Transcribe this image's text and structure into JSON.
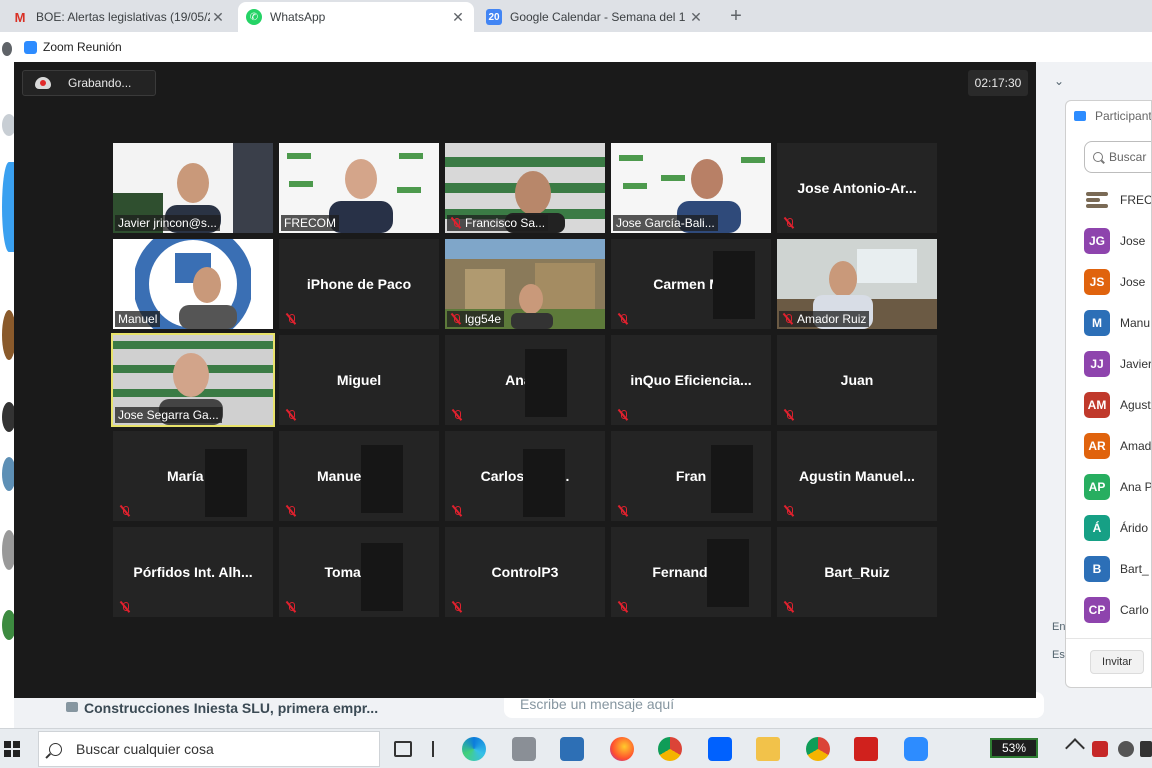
{
  "browser": {
    "tabs": [
      {
        "title": "BOE: Alertas legislativas (19/05/2",
        "icon": "gmail-icon",
        "active": false
      },
      {
        "title": "WhatsApp",
        "icon": "whatsapp-icon",
        "active": true
      },
      {
        "title": "Google Calendar - Semana del 1",
        "icon": "calendar-icon",
        "active": false,
        "badge": "20"
      }
    ],
    "new_tab": "+"
  },
  "zoom": {
    "window_title": "Zoom Reunión",
    "recording_label": "Grabando...",
    "timer": "02:17:30",
    "tiles": [
      {
        "name": "Javier jrincon@s...",
        "video": true,
        "muted": false
      },
      {
        "name": "FRECOM",
        "video": true,
        "muted": false
      },
      {
        "name": "Francisco Sa...",
        "video": true,
        "muted": true
      },
      {
        "name": "Jose García-Bali...",
        "video": true,
        "muted": false
      },
      {
        "name": "Jose  Antonio-Ar...",
        "video": false,
        "muted": true
      },
      {
        "name": "Manuel",
        "video": true,
        "muted": false
      },
      {
        "name": "iPhone de Paco",
        "video": false,
        "muted": true
      },
      {
        "name": "lgg54e",
        "video": true,
        "muted": true
      },
      {
        "name": "Carmen  Ma",
        "video": false,
        "muted": true
      },
      {
        "name": "Amador Ruiz",
        "video": true,
        "muted": true
      },
      {
        "name": "Jose Segarra Ga...",
        "video": true,
        "muted": false,
        "active_speaker": true
      },
      {
        "name": "Miguel",
        "video": false,
        "muted": true
      },
      {
        "name": "Ana P",
        "video": false,
        "muted": true
      },
      {
        "name": "inQuo  Eficiencia...",
        "video": false,
        "muted": true
      },
      {
        "name": "Juan",
        "video": false,
        "muted": true
      },
      {
        "name": "María M",
        "video": false,
        "muted": true
      },
      {
        "name": "Manuel  S          z...",
        "video": false,
        "muted": true
      },
      {
        "name": "Carlos  Pe          ó...",
        "video": false,
        "muted": true
      },
      {
        "name": "Fran",
        "video": false,
        "muted": true
      },
      {
        "name": "Agustin  Manuel...",
        "video": false,
        "muted": true
      },
      {
        "name": "Pórfidos  Int.  Alh...",
        "video": false,
        "muted": true
      },
      {
        "name": "Tomas R          z",
        "video": false,
        "muted": true
      },
      {
        "name": "ControlP3",
        "video": false,
        "muted": true
      },
      {
        "name": "Fernando A",
        "video": false,
        "muted": true
      },
      {
        "name": "Bart_Ruiz",
        "video": false,
        "muted": true
      }
    ],
    "participants_panel": {
      "title": "Participant",
      "search_placeholder": "Buscar",
      "invite_label": "Invitar",
      "participants": [
        {
          "initials": "",
          "name": "FRECO",
          "color": "#7a6a55",
          "logo": true
        },
        {
          "initials": "JG",
          "name": "Jose",
          "color": "#8e44ad"
        },
        {
          "initials": "JS",
          "name": "Jose",
          "color": "#e0630d"
        },
        {
          "initials": "M",
          "name": "Manu",
          "color": "#2c6fb7"
        },
        {
          "initials": "JJ",
          "name": "Javier",
          "color": "#8e44ad"
        },
        {
          "initials": "AM",
          "name": "Agust",
          "color": "#c0392b"
        },
        {
          "initials": "AR",
          "name": "Amad",
          "color": "#e0630d"
        },
        {
          "initials": "AP",
          "name": "Ana P",
          "color": "#27ae60"
        },
        {
          "initials": "Á",
          "name": "Árido",
          "color": "#16a085"
        },
        {
          "initials": "B",
          "name": "Bart_",
          "color": "#2c6fb7"
        },
        {
          "initials": "CP",
          "name": "Carlo",
          "color": "#8e44ad"
        }
      ]
    }
  },
  "background_page": {
    "chat_preview": "Construcciones Iniesta SLU, primera empr...",
    "compose_placeholder": "Escribe un mensaje aquí",
    "side_texts": [
      "En",
      "Es"
    ]
  },
  "taskbar": {
    "search_placeholder": "Buscar cualquier cosa",
    "battery": "53%",
    "apps": [
      "task-view-icon",
      "edge-icon",
      "scanner-icon",
      "signature-icon",
      "firefox-icon",
      "chrome-icon",
      "dropbox-icon",
      "file-explorer-icon",
      "chrome-icon",
      "acrobat-icon",
      "zoom-icon"
    ]
  }
}
